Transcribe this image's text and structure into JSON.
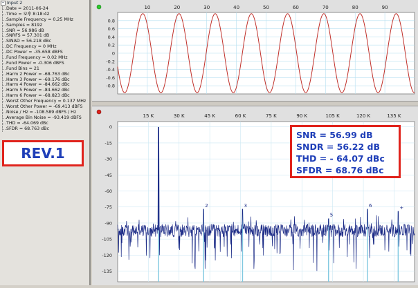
{
  "tree": {
    "root_label": "Input 2",
    "items": [
      "Date = 2011-06-24",
      "Time = 오후 8:18:42",
      "Sample Frequency = 0.25 MHz",
      "Samples = 8192",
      "SNR = 56.986 dB",
      "SNRFS = 57.301 dB",
      "SINAD = 56.218 dBc",
      "DC Frequency = 0 MHz",
      "DC Power = -35.658 dBFS",
      "Fund Frequency = 0.02 MHz",
      "Fund Power = -0.306 dBFS",
      "Fund Bins = 21",
      "Harm 2 Power = -68.763 dBc",
      "Harm 3 Power = -69.176 dBc",
      "Harm 4 Power = -84.662 dBc",
      "Harm 5 Power = -84.662 dBc",
      "Harm 6 Power = -68.823 dBc",
      "Worst Other Frequency = 0.137 MHz",
      "Worst Other Power = -69.413 dBFS",
      "Noise / Hz = -108.589 dBFS / Hz",
      "Average Bin Noise = -93.419 dBFS",
      "THD = -64.069 dBc",
      "SFDR = 68.763 dBc"
    ]
  },
  "rev_label": "REV.1",
  "stats": {
    "snr": "SNR = 56.99 dB",
    "sndr": "SNDR = 56.22 dB",
    "thd": "THD = - 64.07 dBc",
    "sfdr": "SFDR = 68.76 dBc"
  },
  "colors": {
    "waveform": "#c0302a",
    "spectrum": "#1a2a86",
    "marker_line": "#7fc8e0",
    "accent_box": "#e0231c",
    "stat_text": "#1f3fb8"
  },
  "chart_data": [
    {
      "type": "line",
      "title": "",
      "xlabel": "",
      "ylabel": "",
      "xlim": [
        0,
        100
      ],
      "ylim": [
        -1,
        1
      ],
      "x_ticks": [
        "10",
        "20",
        "30",
        "40",
        "50",
        "60",
        "70",
        "80",
        "90"
      ],
      "y_ticks": [
        "0.8",
        "0.6",
        "0.4",
        "0.2",
        "0",
        "-0.2",
        "-0.4",
        "-0.6",
        "-0.8"
      ],
      "series": [
        {
          "cycles": 8.2,
          "amplitude": 0.97,
          "phase_deg": 200
        }
      ],
      "grid": true
    },
    {
      "type": "line",
      "title": "",
      "xlabel": "",
      "ylabel": "",
      "x_ticks": [
        "15 K",
        "30 K",
        "45 K",
        "60 K",
        "75 K",
        "90 K",
        "105 K",
        "120 K",
        "135 K"
      ],
      "x_tick_values": [
        15000,
        30000,
        45000,
        60000,
        75000,
        90000,
        105000,
        120000,
        135000
      ],
      "xlim": [
        0,
        145000
      ],
      "y_ticks": [
        "0",
        "-15",
        "-30",
        "-45",
        "-60",
        "-75",
        "-90",
        "-105",
        "-120",
        "-135"
      ],
      "y_tick_values": [
        0,
        -15,
        -30,
        -45,
        -60,
        -75,
        -90,
        -105,
        -120,
        -135
      ],
      "ylim": [
        -145,
        5
      ],
      "noise_floor": -97,
      "fundamental": {
        "freq": 20000,
        "power": -0.3
      },
      "harmonic_markers": [
        {
          "label": "2",
          "freq": 42000,
          "power": -77
        },
        {
          "label": "3",
          "freq": 61000,
          "power": -77
        },
        {
          "label": "5",
          "freq": 103000,
          "power": -86
        },
        {
          "label": "6",
          "freq": 122000,
          "power": -77
        },
        {
          "label": "+",
          "freq": 137000,
          "power": -79
        }
      ],
      "grid": true
    }
  ]
}
